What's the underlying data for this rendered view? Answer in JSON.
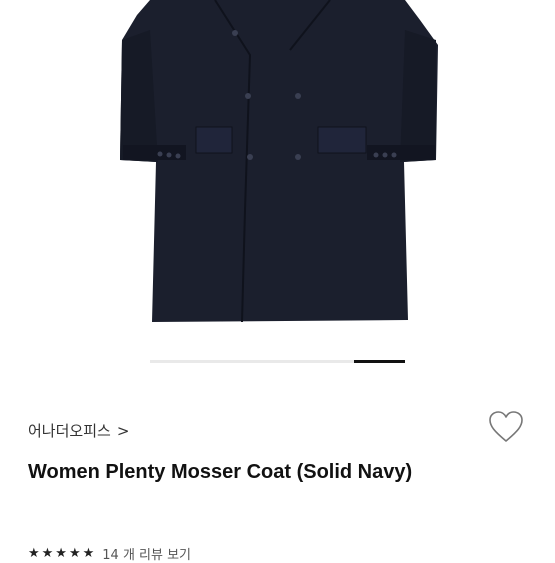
{
  "product": {
    "brand": "어나더오피스",
    "brand_chevron": ">",
    "title": "Women Plenty Mosser Coat (Solid Navy)",
    "rating_stars": "★★★★★",
    "review_link": "14 개 리뷰 보기"
  },
  "carousel": {
    "slides": 5,
    "active_index": 4
  },
  "icons": {
    "wishlist": "heart-outline-icon",
    "brand_arrow": "chevron-right-icon"
  },
  "colors": {
    "coat": "#1b1f2d",
    "accent": "#111111"
  }
}
